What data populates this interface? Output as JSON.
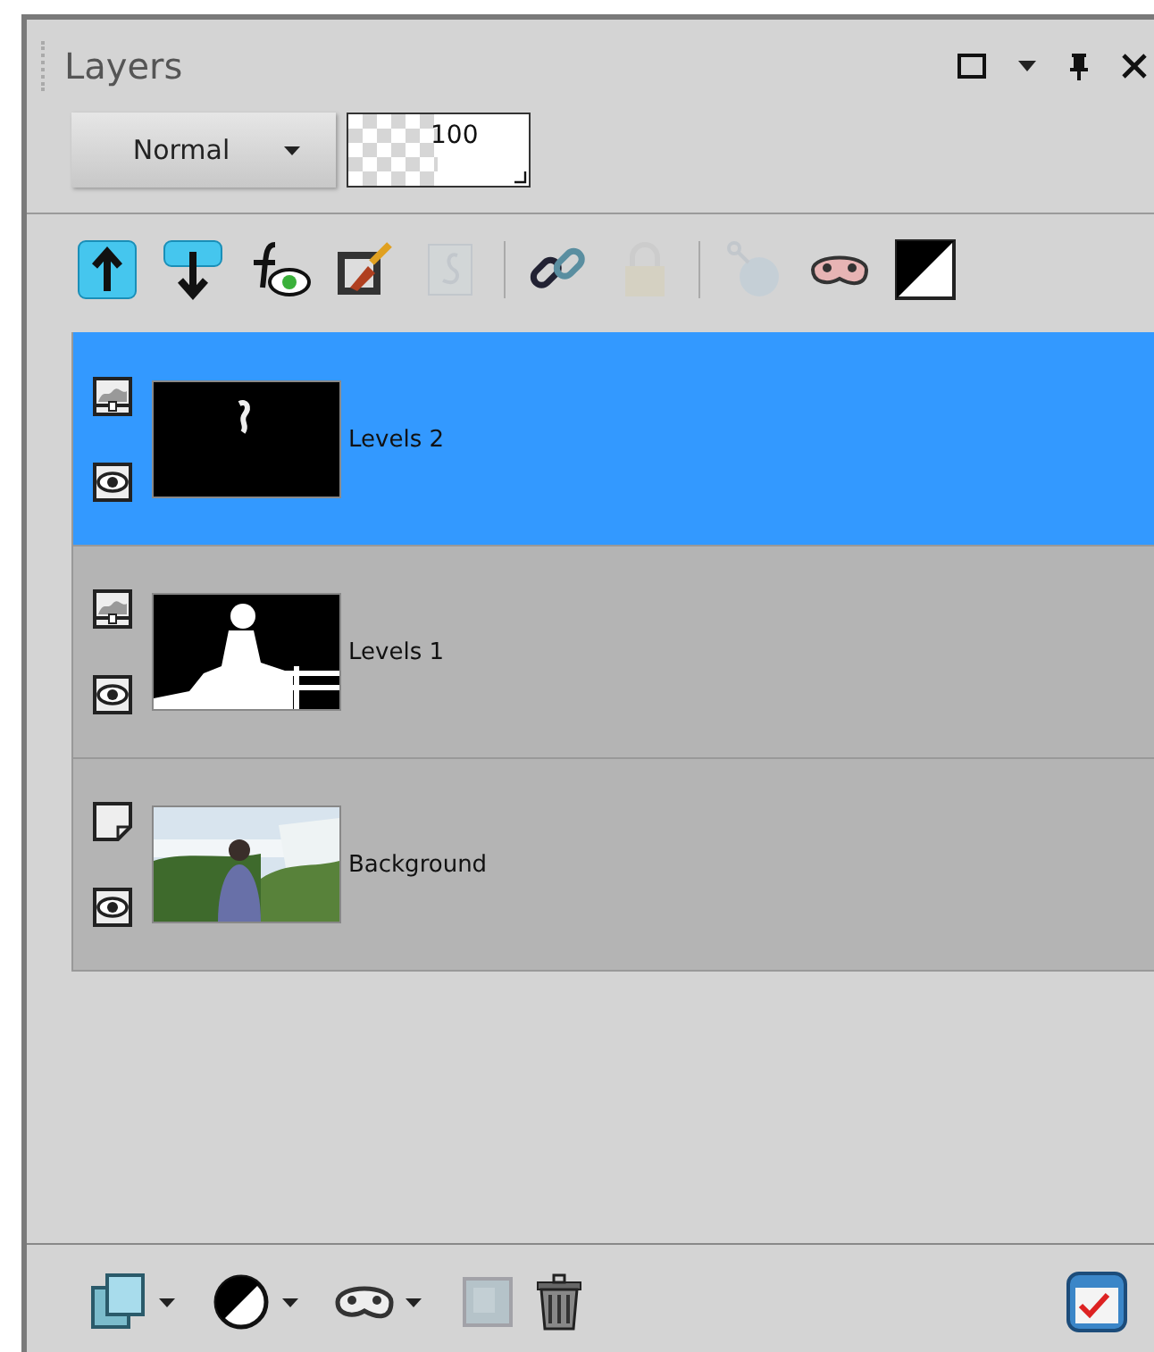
{
  "panel": {
    "title": "Layers"
  },
  "blend_mode": {
    "value": "Normal"
  },
  "opacity": {
    "value": "100"
  },
  "toolbar": [
    {
      "kind": "move-up",
      "disabled": false
    },
    {
      "kind": "move-down",
      "disabled": false
    },
    {
      "kind": "effects",
      "disabled": false
    },
    {
      "kind": "paint",
      "disabled": false
    },
    {
      "kind": "script",
      "disabled": true
    },
    {
      "kind": "separator"
    },
    {
      "kind": "link",
      "disabled": false
    },
    {
      "kind": "lock",
      "disabled": true
    },
    {
      "kind": "separator"
    },
    {
      "kind": "pin",
      "disabled": true
    },
    {
      "kind": "mask",
      "disabled": false
    },
    {
      "kind": "contrast",
      "disabled": false
    }
  ],
  "layers": [
    {
      "name": "Levels 2",
      "kind": "adjustment",
      "selected": true,
      "visible": true
    },
    {
      "name": "Levels 1",
      "kind": "adjustment",
      "selected": false,
      "visible": true
    },
    {
      "name": "Background",
      "kind": "raster",
      "selected": false,
      "visible": true
    }
  ],
  "bottom_toolbar": [
    {
      "kind": "new-layer",
      "menu": true,
      "disabled": false
    },
    {
      "kind": "contrast-circle",
      "menu": true,
      "disabled": false
    },
    {
      "kind": "mask",
      "menu": true,
      "disabled": false
    },
    {
      "kind": "crop",
      "menu": false,
      "disabled": true
    },
    {
      "kind": "trash",
      "menu": false,
      "disabled": false
    }
  ],
  "properties_button": {
    "disabled": false
  }
}
